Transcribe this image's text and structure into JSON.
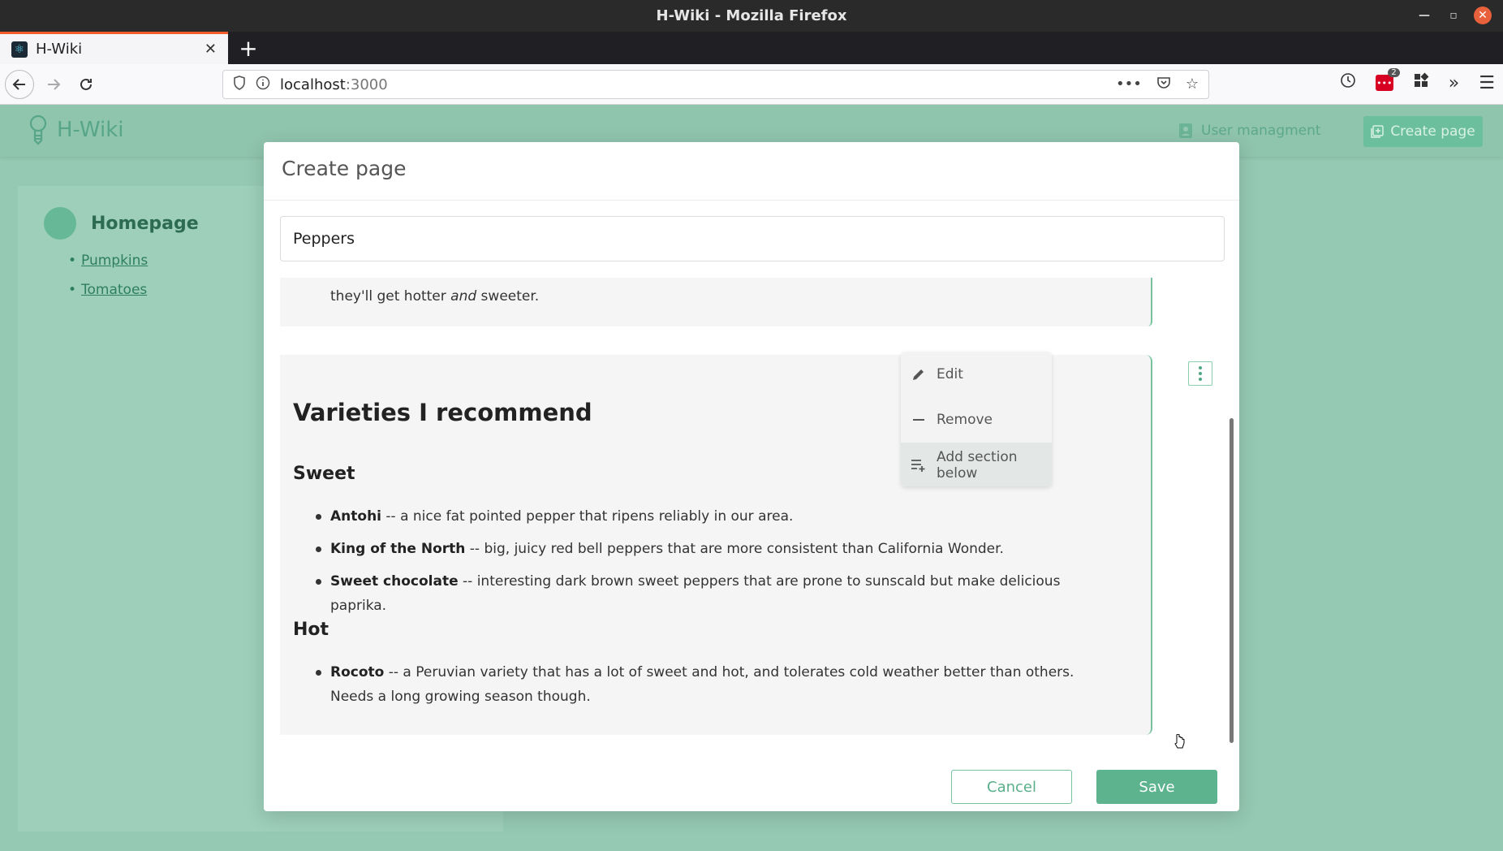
{
  "window": {
    "title": "H-Wiki - Mozilla Firefox"
  },
  "browser": {
    "tab_title": "H-Wiki",
    "url_host": "localhost",
    "url_port": ":3000",
    "extension_badge_count": "2"
  },
  "app": {
    "logo_text": "H-Wiki",
    "user_management_label": "User managment",
    "create_page_label": "Create page"
  },
  "sidebar": {
    "home_label": "Homepage",
    "items": [
      {
        "label": "Pumpkins"
      },
      {
        "label": "Tomatoes"
      }
    ]
  },
  "modal": {
    "title": "Create page",
    "title_input_value": "Peppers",
    "section1": {
      "text_before": "they'll get hotter ",
      "text_em": "and",
      "text_after": " sweeter."
    },
    "section2": {
      "heading": "Varieties I recommend",
      "sweet_heading": "Sweet",
      "sweet_items": [
        {
          "name": "Antohi",
          "desc": " -- a nice fat pointed pepper that ripens reliably in our area."
        },
        {
          "name": "King of the North",
          "desc": " -- big, juicy red bell peppers that are more consistent than California Wonder."
        },
        {
          "name": "Sweet chocolate",
          "desc": " -- interesting dark brown sweet peppers that are prone to sunscald but make delicious paprika."
        }
      ],
      "hot_heading": "Hot",
      "hot_items": [
        {
          "name": "Rocoto",
          "desc": " -- a Peruvian variety that has a lot of sweet and hot, and tolerates cold weather better than others. Needs a long growing season though."
        }
      ]
    },
    "menu": {
      "edit_label": "Edit",
      "remove_label": "Remove",
      "add_section_label": "Add section below"
    },
    "cancel_label": "Cancel",
    "save_label": "Save"
  },
  "colors": {
    "accent": "#5cb38e",
    "page_background": "#95c9b3",
    "firefox_tab_accent": "#f25c2a"
  }
}
